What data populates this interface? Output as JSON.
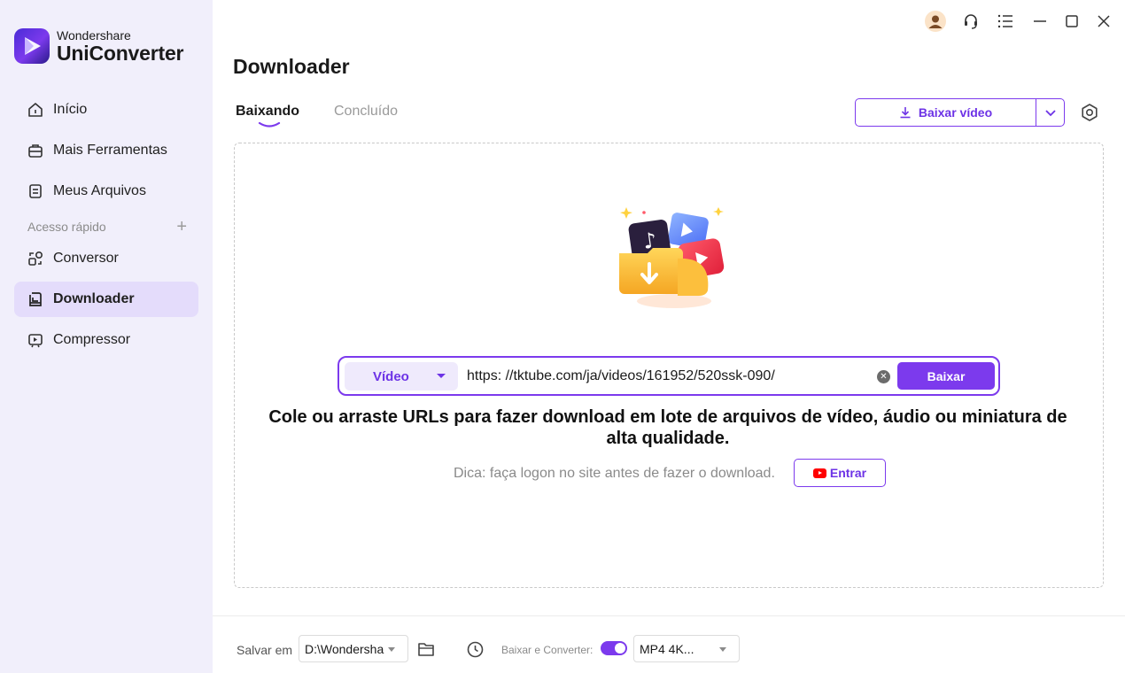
{
  "app": {
    "brand_small": "Wondershare",
    "brand_name": "UniConverter"
  },
  "sidebar": {
    "items": [
      {
        "label": "Início",
        "icon": "home-icon"
      },
      {
        "label": "Mais Ferramentas",
        "icon": "toolbox-icon"
      },
      {
        "label": "Meus Arquivos",
        "icon": "file-icon"
      }
    ],
    "quick_access_label": "Acesso rápido",
    "quick_items": [
      {
        "label": "Conversor",
        "icon": "converter-icon"
      },
      {
        "label": "Downloader",
        "icon": "downloader-icon",
        "active": true
      },
      {
        "label": "Compressor",
        "icon": "compressor-icon"
      }
    ]
  },
  "header": {
    "title": "Downloader"
  },
  "tabs": [
    {
      "label": "Baixando",
      "active": true
    },
    {
      "label": "Concluído"
    }
  ],
  "download_button": {
    "label": "Baixar vídeo"
  },
  "url_bar": {
    "type_select": "Vídeo",
    "url_value": "https: //tktube.com/ja/videos/161952/520ssk-090/",
    "submit_label": "Baixar"
  },
  "main": {
    "headline": "Cole ou arraste URLs para fazer download em lote de arquivos de vídeo, áudio ou miniatura de alta qualidade.",
    "hint": "Dica: faça logon no site antes de fazer o download.",
    "login_label": "Entrar"
  },
  "footer": {
    "save_label": "Salvar em",
    "save_path": "D:\\Wondersha",
    "convert_label": "Baixar e Converter:",
    "convert_enabled": true,
    "format": "MP4 4K..."
  },
  "colors": {
    "accent": "#7c3aed",
    "sidebar_bg": "#f1effb",
    "active_item_bg": "#e4dcfb"
  }
}
